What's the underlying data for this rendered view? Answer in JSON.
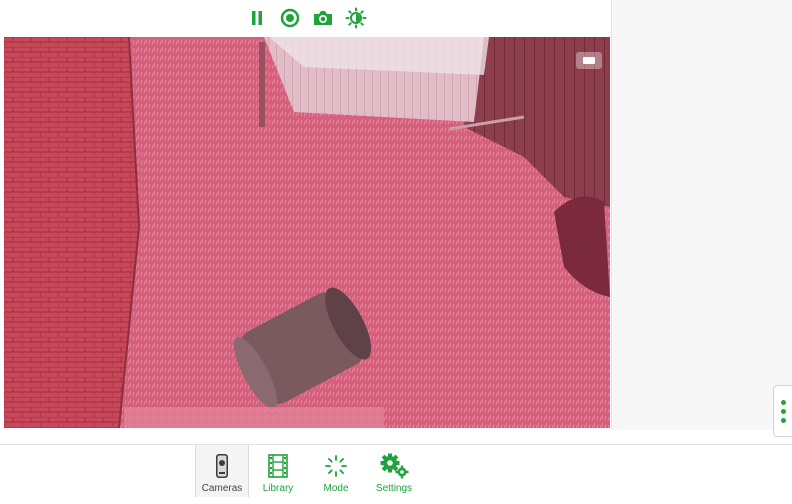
{
  "colors": {
    "accent": "#1fa33a",
    "feed_tint": "#d9607a"
  },
  "toolbar": {
    "buttons": [
      {
        "name": "pause",
        "icon": "pause-icon"
      },
      {
        "name": "record",
        "icon": "record-icon"
      },
      {
        "name": "snapshot",
        "icon": "camera-icon"
      },
      {
        "name": "brightness",
        "icon": "brightness-icon"
      }
    ]
  },
  "feed": {
    "description_icons": [
      "fullscreen-icon"
    ]
  },
  "nav": {
    "cameras": {
      "label": "Cameras",
      "icon": "camera-device-icon"
    },
    "library": {
      "label": "Library",
      "icon": "film-strip-icon"
    },
    "mode": {
      "label": "Mode",
      "icon": "mode-spinner-icon"
    },
    "settings": {
      "label": "Settings",
      "icon": "gears-icon"
    }
  }
}
